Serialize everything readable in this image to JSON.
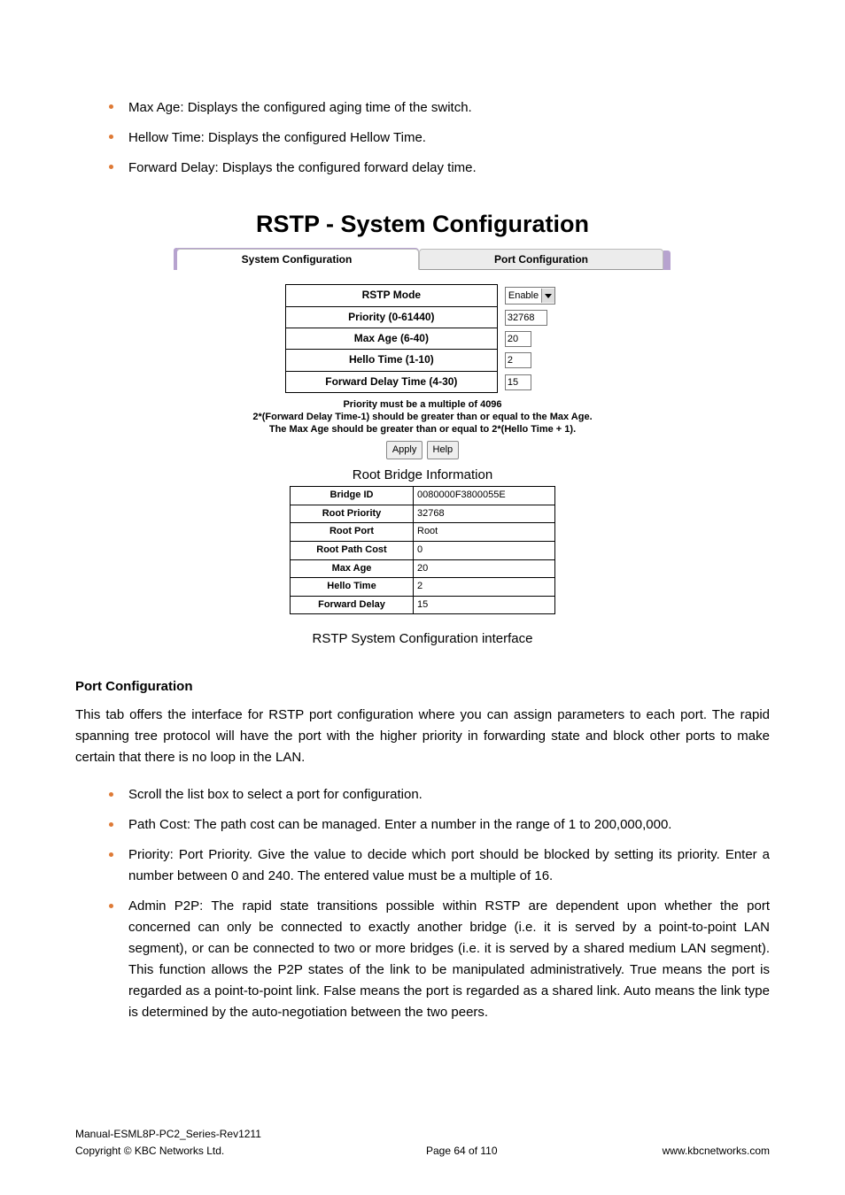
{
  "top_bullets": [
    "Max Age: Displays the configured aging time of the switch.",
    "Hellow Time: Displays the configured Hellow Time.",
    "Forward Delay: Displays the configured forward delay time."
  ],
  "screenshot": {
    "title": "RSTP - System Configuration",
    "tabs": {
      "system": "System Configuration",
      "port": "Port Configuration"
    },
    "config_rows": [
      {
        "label": "RSTP Mode",
        "type": "select",
        "value": "Enable",
        "width": "wide"
      },
      {
        "label": "Priority (0-61440)",
        "type": "text",
        "value": "32768",
        "width": "wide"
      },
      {
        "label": "Max Age (6-40)",
        "type": "text",
        "value": "20",
        "width": "narrow"
      },
      {
        "label": "Hello Time (1-10)",
        "type": "text",
        "value": "2",
        "width": "narrow"
      },
      {
        "label": "Forward Delay Time (4-30)",
        "type": "text",
        "value": "15",
        "width": "narrow"
      }
    ],
    "notes": [
      "Priority must be a multiple of 4096",
      "2*(Forward Delay Time-1) should be greater than or equal to the Max Age.",
      "The Max Age should be greater than or equal to 2*(Hello Time + 1)."
    ],
    "buttons": {
      "apply": "Apply",
      "help": "Help"
    },
    "rbi": {
      "title": "Root Bridge Information",
      "rows": [
        {
          "k": "Bridge ID",
          "v": "0080000F3800055E"
        },
        {
          "k": "Root Priority",
          "v": "32768"
        },
        {
          "k": "Root Port",
          "v": "Root"
        },
        {
          "k": "Root Path Cost",
          "v": "0"
        },
        {
          "k": "Max Age",
          "v": "20"
        },
        {
          "k": "Hello Time",
          "v": "2"
        },
        {
          "k": "Forward Delay",
          "v": "15"
        }
      ]
    },
    "caption": "RSTP System Configuration interface"
  },
  "section": {
    "heading": "Port Configuration",
    "para": "This tab offers the interface for RSTP port configuration where you can assign parameters to each port. The rapid spanning tree protocol will have the port with the higher priority in forwarding state and block other ports to make certain that there is no loop in the LAN."
  },
  "mid_bullets": [
    "Scroll the list box to select a port for configuration.",
    "Path Cost: The path cost can be managed. Enter a number in the range of 1 to 200,000,000.",
    "Priority: Port Priority. Give the value to decide which port should be blocked by setting its priority. Enter a number between 0 and 240. The entered value must be a multiple of 16.",
    "Admin P2P: The rapid state transitions possible within RSTP are dependent upon whether the port concerned can only be connected to exactly another bridge (i.e. it is served by a point-to-point LAN segment), or can be connected to two or more bridges (i.e. it is served by a shared medium LAN segment). This function allows the P2P states of the link to be manipulated administratively. True means the port is regarded as a point-to-point link. False means the port is regarded as a shared link. Auto means the link type is determined by the auto-negotiation between the two peers."
  ],
  "footer": {
    "left1": "Manual-ESML8P-PC2_Series-Rev1211",
    "left2": "Copyright © KBC Networks Ltd.",
    "center": "Page 64 of 110",
    "right": "www.kbcnetworks.com"
  }
}
